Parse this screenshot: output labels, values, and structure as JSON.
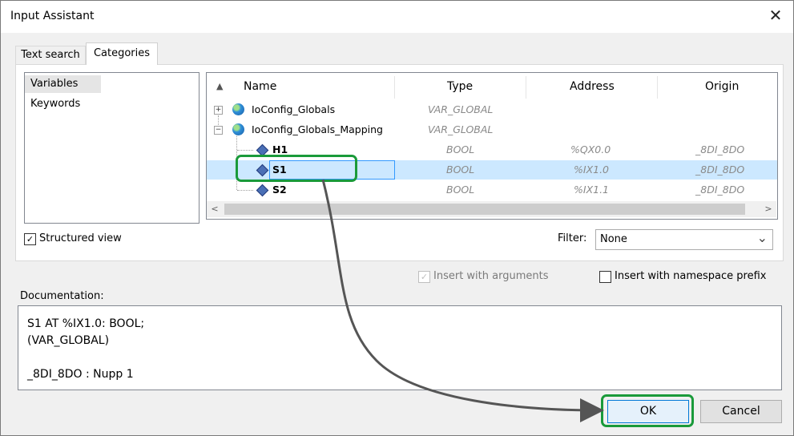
{
  "window": {
    "title": "Input Assistant",
    "close_symbol": "✕"
  },
  "tabs": [
    {
      "label": "Text search"
    },
    {
      "label": "Categories"
    }
  ],
  "categories": [
    {
      "label": "Variables"
    },
    {
      "label": "Keywords"
    }
  ],
  "tree": {
    "sort_symbol": "▲",
    "columns": [
      "Name",
      "Type",
      "Address",
      "Origin"
    ],
    "rows": [
      {
        "expander": "+",
        "name": "IoConfig_Globals",
        "type": "VAR_GLOBAL",
        "address": "",
        "origin": ""
      },
      {
        "expander": "−",
        "name": "IoConfig_Globals_Mapping",
        "type": "VAR_GLOBAL",
        "address": "",
        "origin": ""
      },
      {
        "name": "H1",
        "type": "BOOL",
        "address": "%QX0.0",
        "origin": "_8DI_8DO"
      },
      {
        "name": "S1",
        "type": "BOOL",
        "address": "%IX1.0",
        "origin": "_8DI_8DO",
        "selected": true
      },
      {
        "name": "S2",
        "type": "BOOL",
        "address": "%IX1.1",
        "origin": "_8DI_8DO"
      }
    ]
  },
  "scroll": {
    "left_arrow": "<",
    "right_arrow": ">"
  },
  "structured_view": {
    "label": "Structured view",
    "checked": true,
    "mark": "✓"
  },
  "filter": {
    "label": "Filter:",
    "value": "None",
    "arrow": "⌄"
  },
  "insert_with_arguments": {
    "label": "Insert with arguments",
    "checked": true,
    "disabled": true,
    "mark": "✓"
  },
  "insert_with_namespace": {
    "label": "Insert with namespace prefix",
    "checked": false
  },
  "documentation": {
    "label": "Documentation:",
    "lines": [
      "S1 AT %IX1.0: BOOL;",
      "(VAR_GLOBAL)",
      "",
      "_8DI_8DO : Nupp 1"
    ]
  },
  "buttons": {
    "ok": "OK",
    "cancel": "Cancel"
  },
  "colors": {
    "highlight": "#1a9a3a",
    "selection": "#cce8ff",
    "arrow": "#555555"
  }
}
